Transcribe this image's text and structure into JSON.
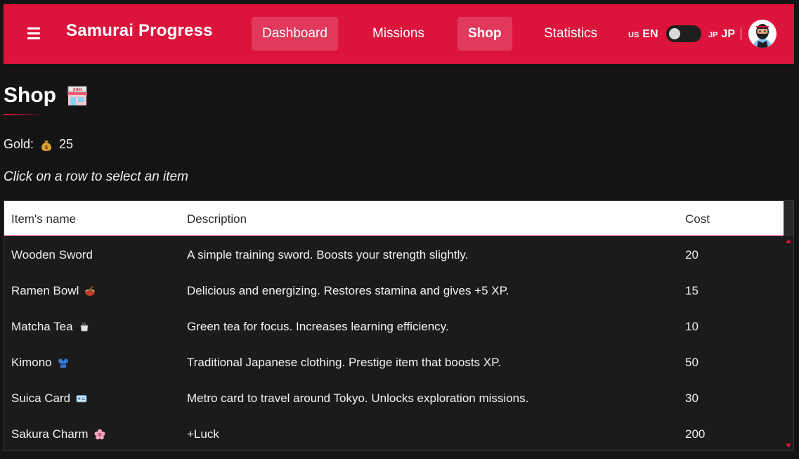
{
  "header": {
    "brand": "Samurai Progress",
    "nav": [
      {
        "label": "Dashboard"
      },
      {
        "label": "Missions"
      },
      {
        "label": "Shop"
      },
      {
        "label": "Statistics"
      }
    ],
    "lang_left_code": "US",
    "lang_left_label": "EN",
    "lang_right_code": "JP",
    "lang_right_label": "JP",
    "toggle_on": false,
    "colors": {
      "bar": "#dc143c",
      "text": "#ffffff"
    }
  },
  "page": {
    "title": "Shop",
    "title_icon": "convenience-store-icon",
    "gold_label": "Gold:",
    "gold_icon": "money-bag-icon",
    "gold_value": "25",
    "hint": "Click on a row to select an item"
  },
  "table": {
    "headers": {
      "name": "Item's name",
      "description": "Description",
      "cost": "Cost"
    },
    "rows": [
      {
        "name": "Wooden Sword",
        "icon": "",
        "description": "A simple training sword. Boosts your strength slightly.",
        "cost": "20"
      },
      {
        "name": "Ramen Bowl",
        "icon": "ramen-icon",
        "description": "Delicious and energizing. Restores stamina and gives +5 XP.",
        "cost": "15"
      },
      {
        "name": "Matcha Tea",
        "icon": "tea-icon",
        "description": "Green tea for focus. Increases learning efficiency.",
        "cost": "10"
      },
      {
        "name": "Kimono",
        "icon": "kimono-icon",
        "description": "Traditional Japanese clothing. Prestige item that boosts XP.",
        "cost": "50"
      },
      {
        "name": "Suica Card",
        "icon": "id-card-icon",
        "description": "Metro card to travel around Tokyo. Unlocks exploration missions.",
        "cost": "30"
      },
      {
        "name": "Sakura Charm",
        "icon": "cherry-blossom-icon",
        "description": "+Luck",
        "cost": "200"
      }
    ]
  }
}
